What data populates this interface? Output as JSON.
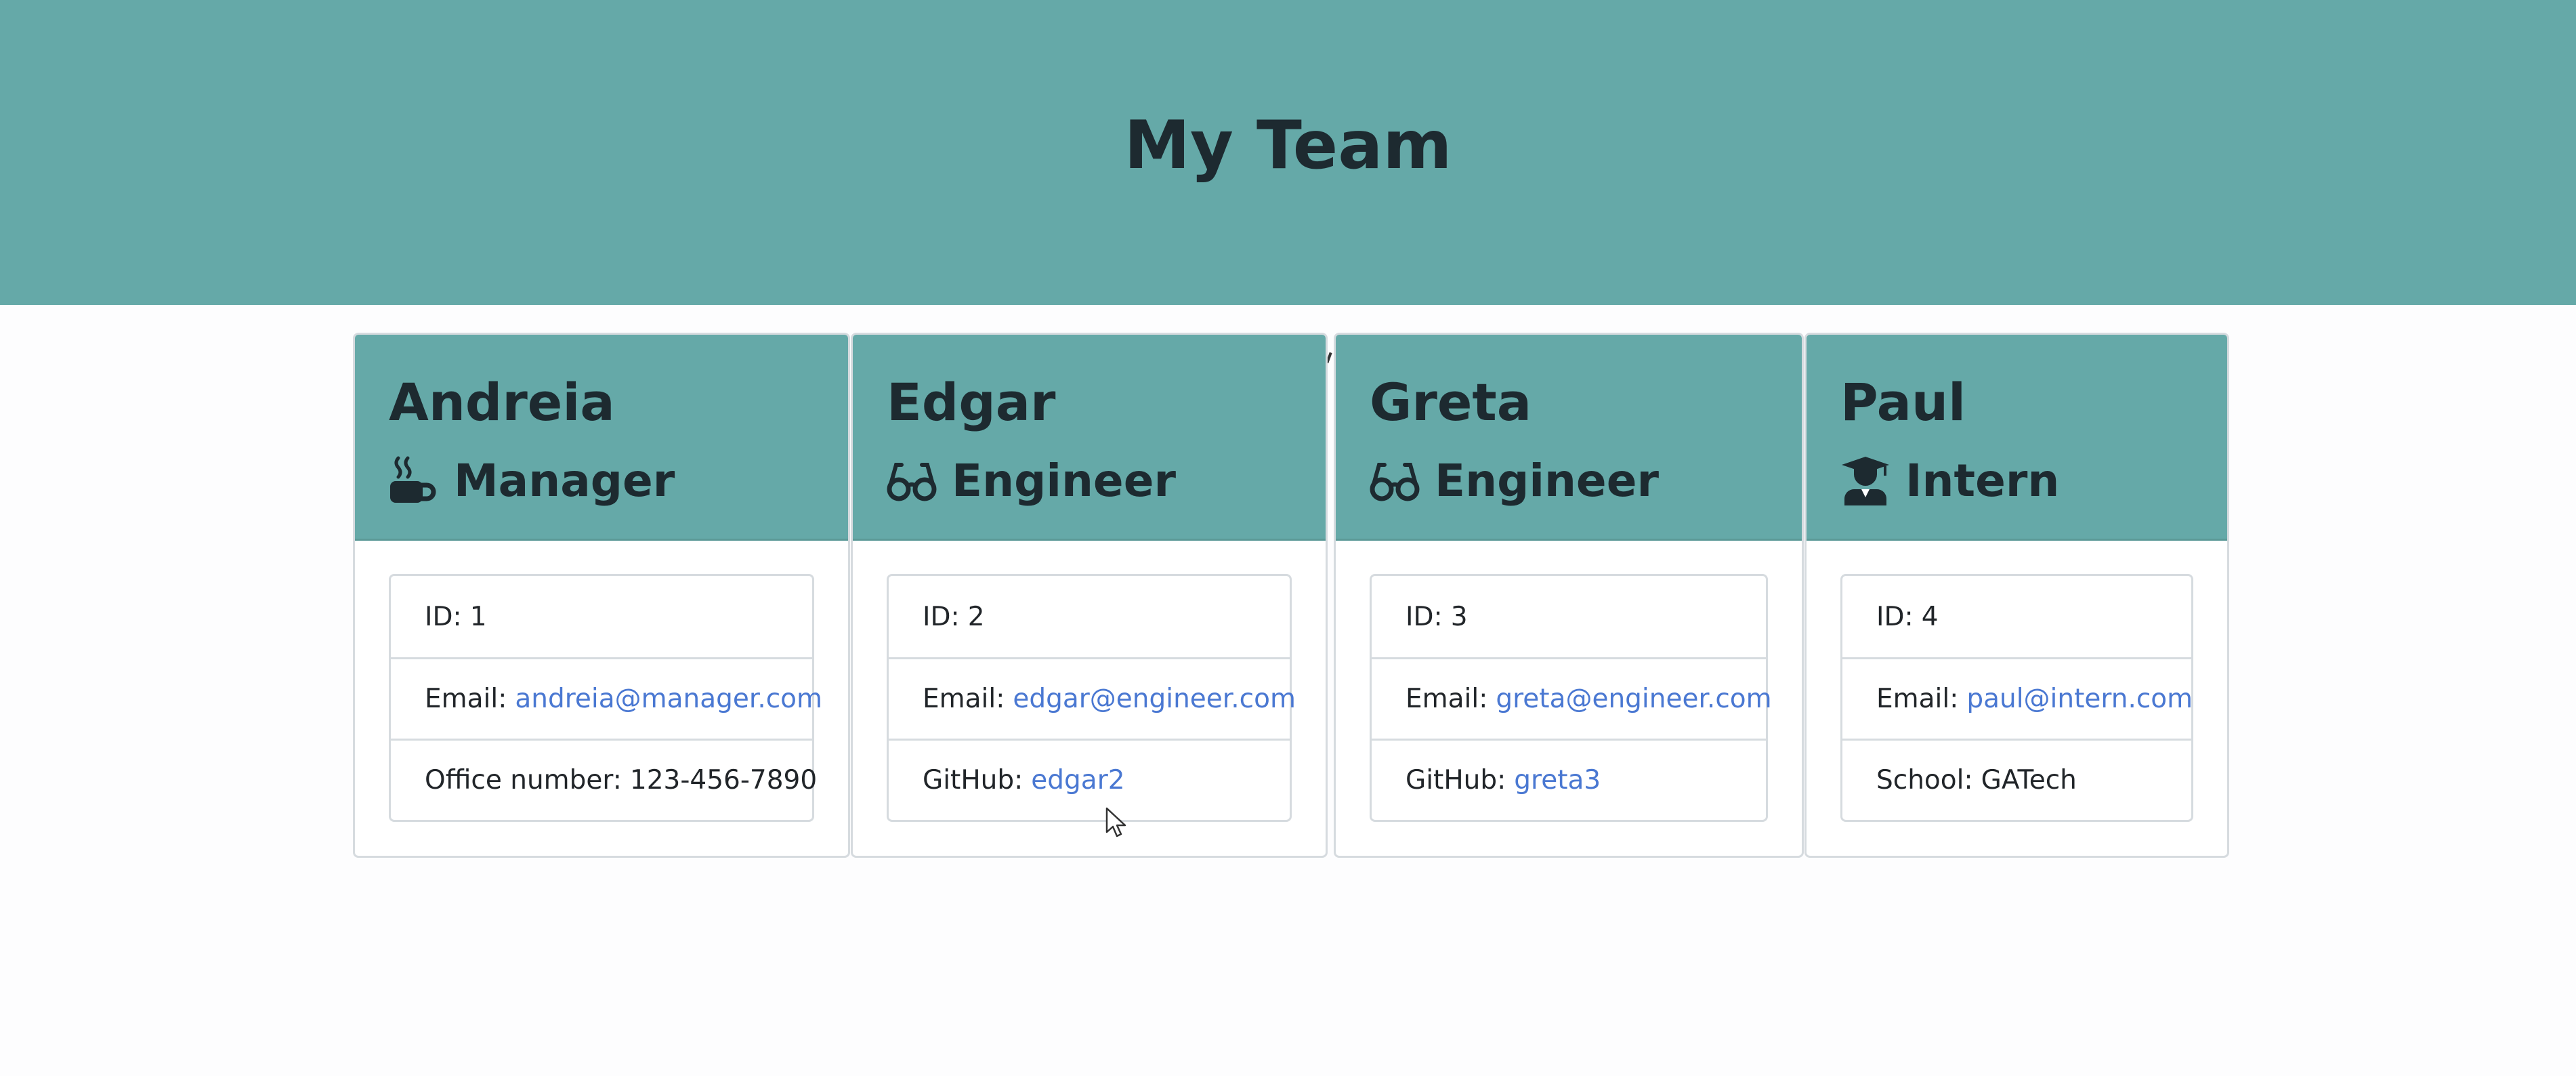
{
  "header": {
    "title": "My Team"
  },
  "team": [
    {
      "name": "Andreia",
      "role": "Manager",
      "icon": "mug-icon",
      "id_label": "ID:",
      "id": "1",
      "email_label": "Email:",
      "email": "andreia@manager.com",
      "extra_label": "Office number:",
      "extra_value": "123-456-7890"
    },
    {
      "name": "Edgar",
      "role": "Engineer",
      "icon": "glasses-icon",
      "id_label": "ID:",
      "id": "2",
      "email_label": "Email:",
      "email": "edgar@engineer.com",
      "extra_label": "GitHub:",
      "extra_value": "edgar2"
    },
    {
      "name": "Greta",
      "role": "Engineer",
      "icon": "glasses-icon",
      "id_label": "ID:",
      "id": "3",
      "email_label": "Email:",
      "email": "greta@engineer.com",
      "extra_label": "GitHub:",
      "extra_value": "greta3"
    },
    {
      "name": "Paul",
      "role": "Intern",
      "icon": "graduate-icon",
      "id_label": "ID:",
      "id": "4",
      "email_label": "Email:",
      "email": "paul@intern.com",
      "extra_label": "School:",
      "extra_value": "GATech"
    }
  ],
  "colors": {
    "header_bg": "#65a9a8",
    "link": "#4a78d2",
    "text": "#212529"
  }
}
